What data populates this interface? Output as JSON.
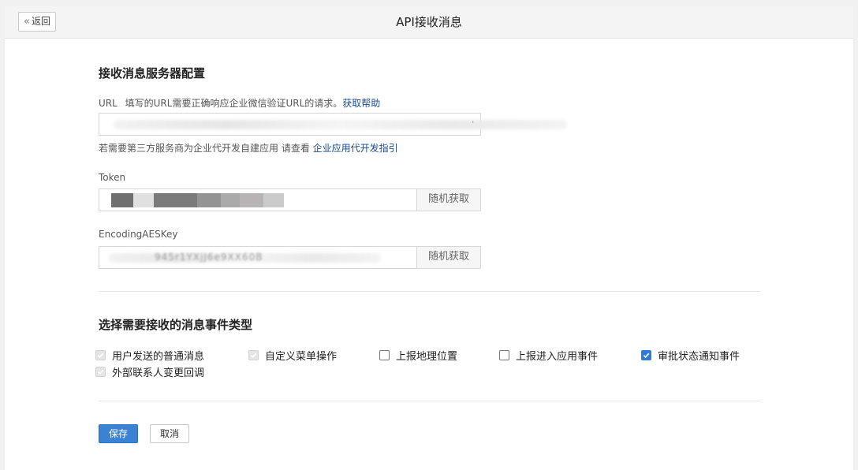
{
  "header": {
    "back_label": "返回",
    "back_icon": "double-chevron-left-icon",
    "title": "API接收消息"
  },
  "server_config": {
    "title": "接收消息服务器配置",
    "url": {
      "label": "URL",
      "hint": "填写的URL需要正确响应企业微信验证URL的请求。",
      "help_link": "获取帮助",
      "value": ""
    },
    "agent_note": {
      "text": "若需要第三方服务商为企业代开发自建应用 请查看 ",
      "link": "企业应用代开发指引"
    },
    "token": {
      "label": "Token",
      "value": "",
      "random_button": "随机获取"
    },
    "aes_key": {
      "label": "EncodingAESKey",
      "value": "",
      "visible_fragment": "945r1YXjJ6e9XX60B",
      "random_button": "随机获取"
    }
  },
  "events": {
    "title": "选择需要接收的消息事件类型",
    "options": [
      {
        "label": "用户发送的普通消息",
        "checked": true,
        "disabled": true
      },
      {
        "label": "自定义菜单操作",
        "checked": true,
        "disabled": true
      },
      {
        "label": "上报地理位置",
        "checked": false,
        "disabled": false
      },
      {
        "label": "上报进入应用事件",
        "checked": false,
        "disabled": false
      },
      {
        "label": "审批状态通知事件",
        "checked": true,
        "disabled": false
      },
      {
        "label": "外部联系人变更回调",
        "checked": true,
        "disabled": true
      }
    ]
  },
  "actions": {
    "save": "保存",
    "cancel": "取消"
  },
  "colors": {
    "primary": "#3b83d2",
    "link": "#1c4b8f",
    "checkbox_checked": "#2f7cd8",
    "checkbox_disabled": "#e5e5e5"
  }
}
